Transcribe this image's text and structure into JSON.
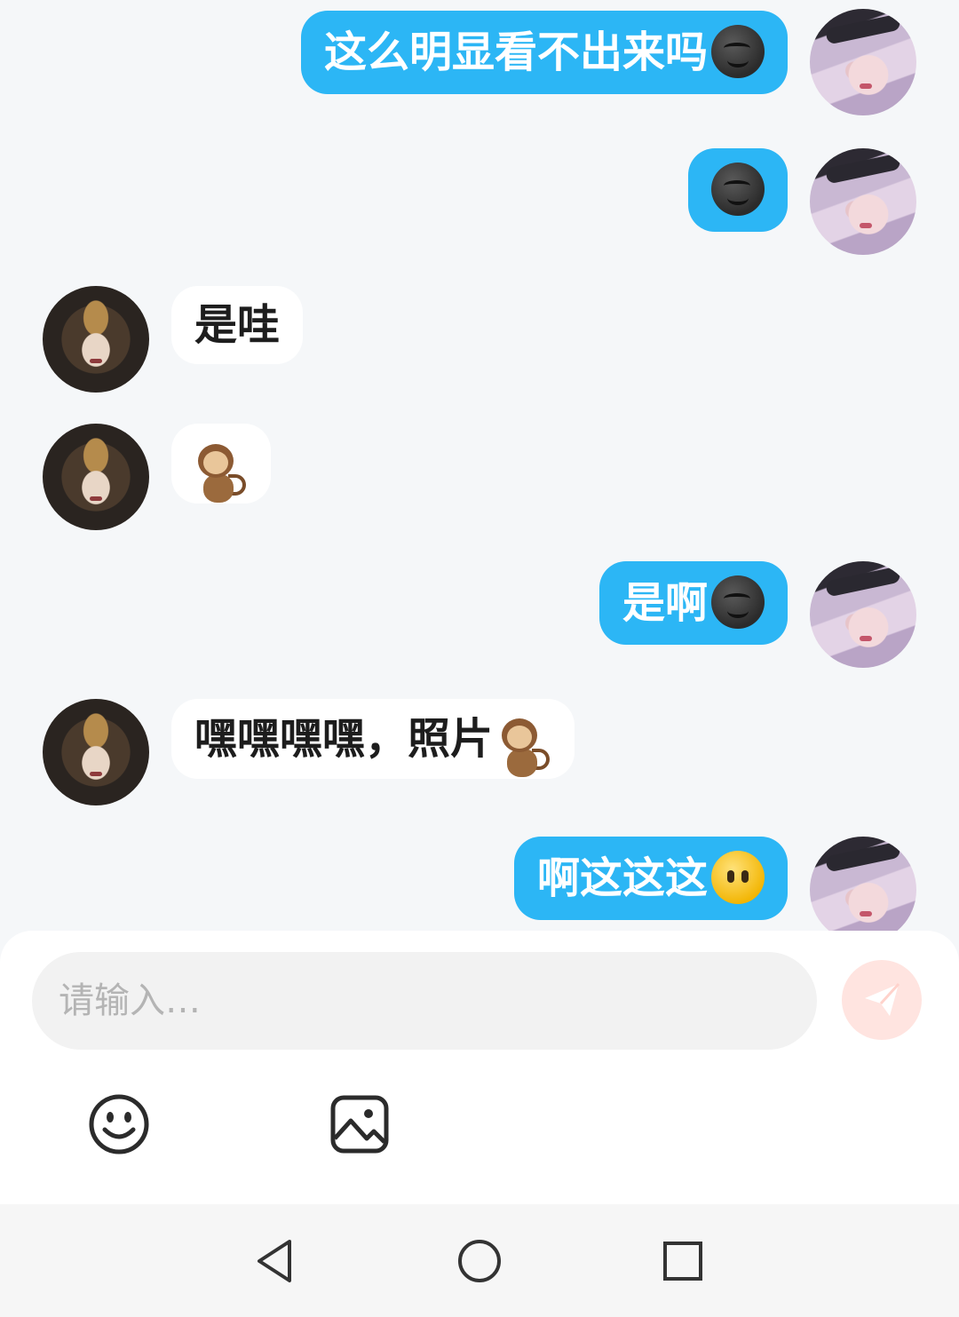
{
  "messages": [
    {
      "side": "me",
      "text": "这么明显看不出来吗",
      "emoji": "dark-moon-face-icon"
    },
    {
      "side": "me",
      "text": "",
      "emoji": "dark-moon-face-icon"
    },
    {
      "side": "other",
      "text": "是哇",
      "emoji": ""
    },
    {
      "side": "other",
      "text": "",
      "emoji": "monkey-icon"
    },
    {
      "side": "me",
      "text": "是啊",
      "emoji": "dark-moon-face-icon"
    },
    {
      "side": "other",
      "text": "嘿嘿嘿嘿，照片",
      "emoji": "monkey-icon"
    },
    {
      "side": "me",
      "text": "啊这这这",
      "emoji": "face-without-mouth-icon"
    }
  ],
  "input": {
    "placeholder": "请输入…",
    "value": ""
  },
  "toolbar": {
    "emoji_icon": "smiley-icon",
    "image_icon": "image-icon",
    "send_icon": "paper-plane-icon"
  },
  "colors": {
    "my_bubble": "#2cb6f5",
    "other_bubble": "#ffffff",
    "background": "#f5f7f9",
    "send_button_disabled": "#ffe4e0"
  },
  "navbar": {
    "back_icon": "triangle-back-icon",
    "home_icon": "circle-home-icon",
    "recent_icon": "square-recents-icon"
  }
}
